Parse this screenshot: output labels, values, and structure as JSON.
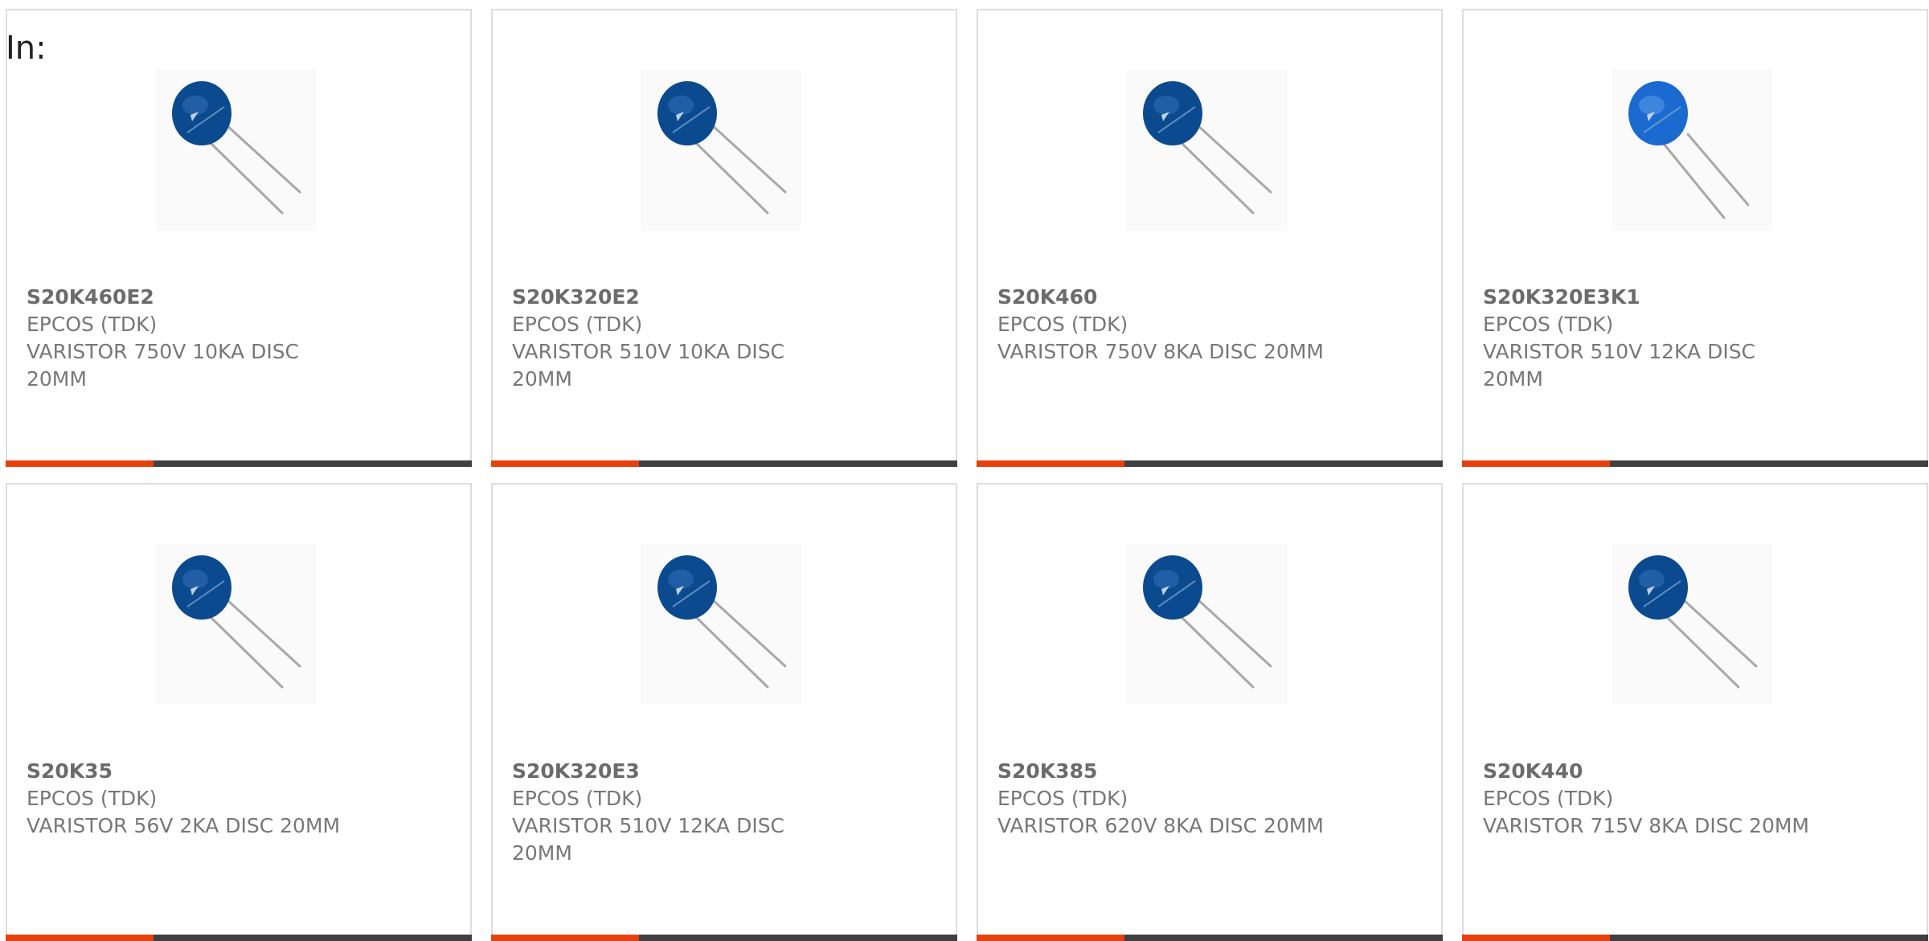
{
  "filter_label": "In:",
  "colors": {
    "accent": "#e8400c",
    "bar": "#404040",
    "varistor_dark": "#0b4a8e",
    "varistor_bright": "#1a6ad0"
  },
  "products": [
    {
      "part_number": "S20K460E2",
      "manufacturer": "EPCOS (TDK)",
      "description": "VARISTOR 750V 10KA DISC 20MM",
      "image_icon": "varistor-disc-icon"
    },
    {
      "part_number": "S20K320E2",
      "manufacturer": "EPCOS (TDK)",
      "description": "VARISTOR 510V 10KA DISC 20MM",
      "image_icon": "varistor-disc-icon"
    },
    {
      "part_number": "S20K460",
      "manufacturer": "EPCOS (TDK)",
      "description": "VARISTOR 750V 8KA DISC 20MM",
      "image_icon": "varistor-disc-icon"
    },
    {
      "part_number": "S20K320E3K1",
      "manufacturer": "EPCOS (TDK)",
      "description": "VARISTOR 510V 12KA DISC 20MM",
      "image_icon": "varistor-disc-icon"
    },
    {
      "part_number": "S20K35",
      "manufacturer": "EPCOS (TDK)",
      "description": "VARISTOR 56V 2KA DISC 20MM",
      "image_icon": "varistor-disc-icon"
    },
    {
      "part_number": "S20K320E3",
      "manufacturer": "EPCOS (TDK)",
      "description": "VARISTOR 510V 12KA DISC 20MM",
      "image_icon": "varistor-disc-icon"
    },
    {
      "part_number": "S20K385",
      "manufacturer": "EPCOS (TDK)",
      "description": "VARISTOR 620V 8KA DISC 20MM",
      "image_icon": "varistor-disc-icon"
    },
    {
      "part_number": "S20K440",
      "manufacturer": "EPCOS (TDK)",
      "description": "VARISTOR 715V 8KA DISC 20MM",
      "image_icon": "varistor-disc-icon"
    }
  ]
}
